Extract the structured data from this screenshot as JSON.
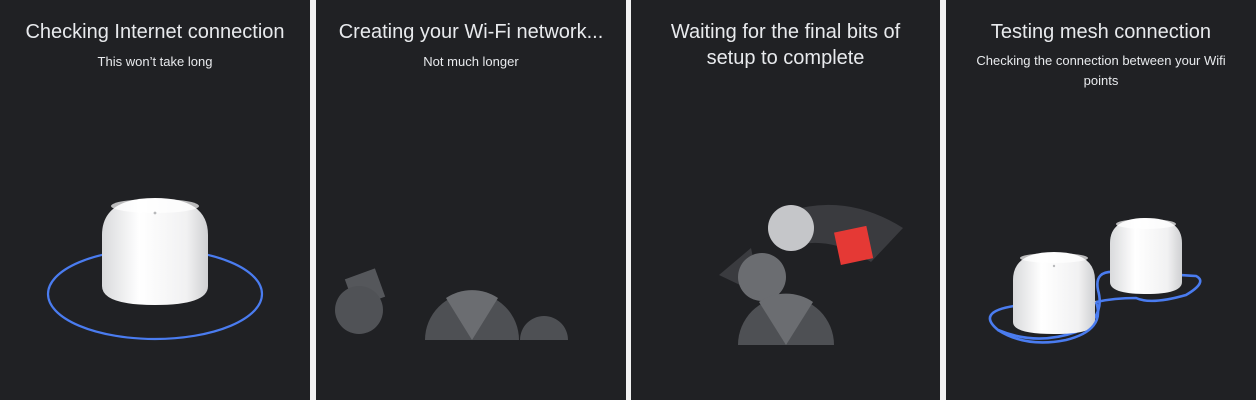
{
  "panels": [
    {
      "title": "Checking Internet connection",
      "subtitle": "This won’t take long",
      "illustration": "router-ring-icon"
    },
    {
      "title": "Creating your Wi-Fi network...",
      "subtitle": "Not much longer",
      "illustration": "shapes-icon"
    },
    {
      "title": "Waiting for the final bits of setup to complete",
      "subtitle": "",
      "illustration": "shapes-icon"
    },
    {
      "title": "Testing mesh connection",
      "subtitle": "Checking the connection between your Wifi points",
      "illustration": "mesh-routers-icon"
    }
  ],
  "colors": {
    "background": "#202124",
    "text": "#e8eaed",
    "accent_blue": "#4a7cf0",
    "accent_red": "#e53935",
    "shape_dark": "#55575b",
    "shape_mid": "#6b6d71",
    "shape_light": "#c5c6c9"
  }
}
